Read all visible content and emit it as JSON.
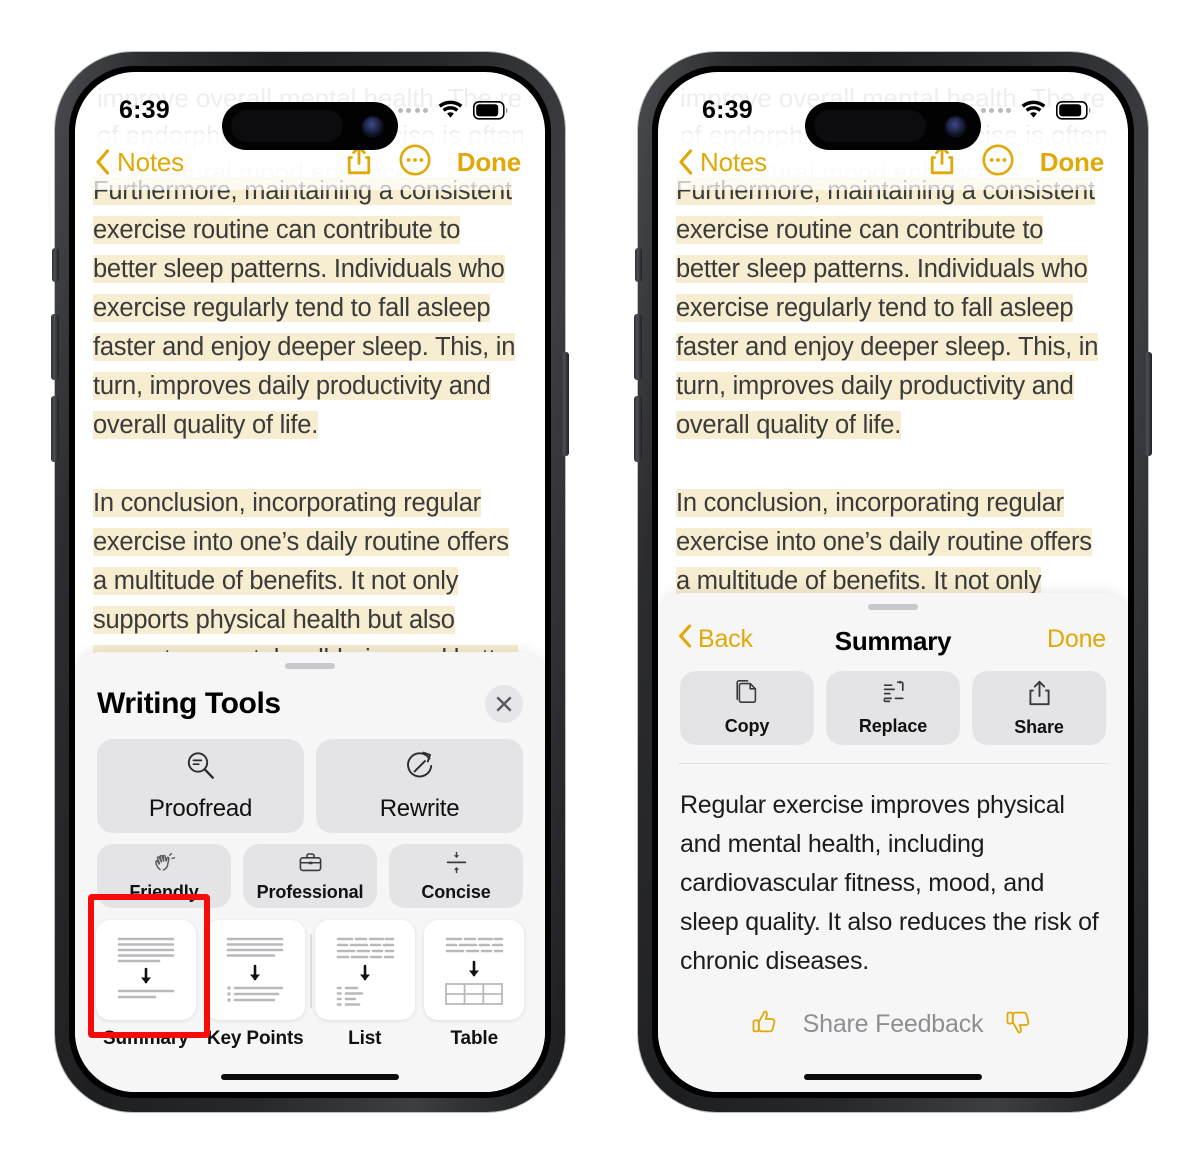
{
  "statusbar": {
    "time": "6:39",
    "cellular_icon": "cellular-dots-icon",
    "wifi_icon": "wifi-icon",
    "battery_icon": "battery-icon"
  },
  "navbar": {
    "back_label": "Notes",
    "back_icon": "chevron-left-icon",
    "share_icon": "share-icon",
    "more_icon": "ellipsis-circle-icon",
    "done_label": "Done"
  },
  "note": {
    "ghost_line_1": "improve overall mental health. The release",
    "ghost_line_2": "of endorphins during exercise is often cited",
    "ghost_line_3": "as a natural mood enhancer.",
    "paragraph_1": "Furthermore, maintaining a consistent exercise routine can contribute to better sleep patterns. Individuals who exercise regularly tend to fall asleep faster and enjoy deeper sleep. This, in turn, improves daily productivity and overall quality of life.",
    "paragraph_2": "In conclusion, incorporating regular exercise into one’s daily routine offers a multitude of benefits. It not only supports physical health but also promotes mental well-being and better sleep. For these reasons, it is essential to prioritize regular physical activity as part of a healthy lifestyle.",
    "highlight_color": "#f7edd0",
    "selection_handle_color": "#e8b007"
  },
  "writing_tools": {
    "title": "Writing Tools",
    "close_icon": "close-icon",
    "primary_actions": [
      {
        "label": "Proofread",
        "icon": "proofread-magnifier-icon"
      },
      {
        "label": "Rewrite",
        "icon": "rewrite-circular-arrow-icon"
      }
    ],
    "tone_actions": [
      {
        "label": "Friendly",
        "icon": "waving-hand-icon"
      },
      {
        "label": "Professional",
        "icon": "briefcase-icon"
      },
      {
        "label": "Concise",
        "icon": "compress-arrows-icon"
      }
    ],
    "transform_cards": [
      {
        "label": "Summary",
        "icon": "summary-card-icon"
      },
      {
        "label": "Key Points",
        "icon": "key-points-card-icon"
      },
      {
        "label": "List",
        "icon": "list-card-icon"
      },
      {
        "label": "Table",
        "icon": "table-card-icon"
      }
    ],
    "highlighted_card": "Summary",
    "highlight_box_color": "#f60a0a"
  },
  "summary_panel": {
    "back_label": "Back",
    "back_icon": "chevron-left-icon",
    "title": "Summary",
    "done_label": "Done",
    "actions": [
      {
        "label": "Copy",
        "icon": "copy-documents-icon"
      },
      {
        "label": "Replace",
        "icon": "replace-arrows-icon"
      },
      {
        "label": "Share",
        "icon": "share-icon"
      }
    ],
    "result_text": "Regular exercise improves physical and mental health, including cardiovascular fitness, mood, and sleep quality. It also reduces the risk of chronic diseases.",
    "feedback_label": "Share Feedback",
    "thumbs_up_icon": "thumbs-up-icon",
    "thumbs_down_icon": "thumbs-down-icon",
    "accent_color": "#e0a907"
  }
}
